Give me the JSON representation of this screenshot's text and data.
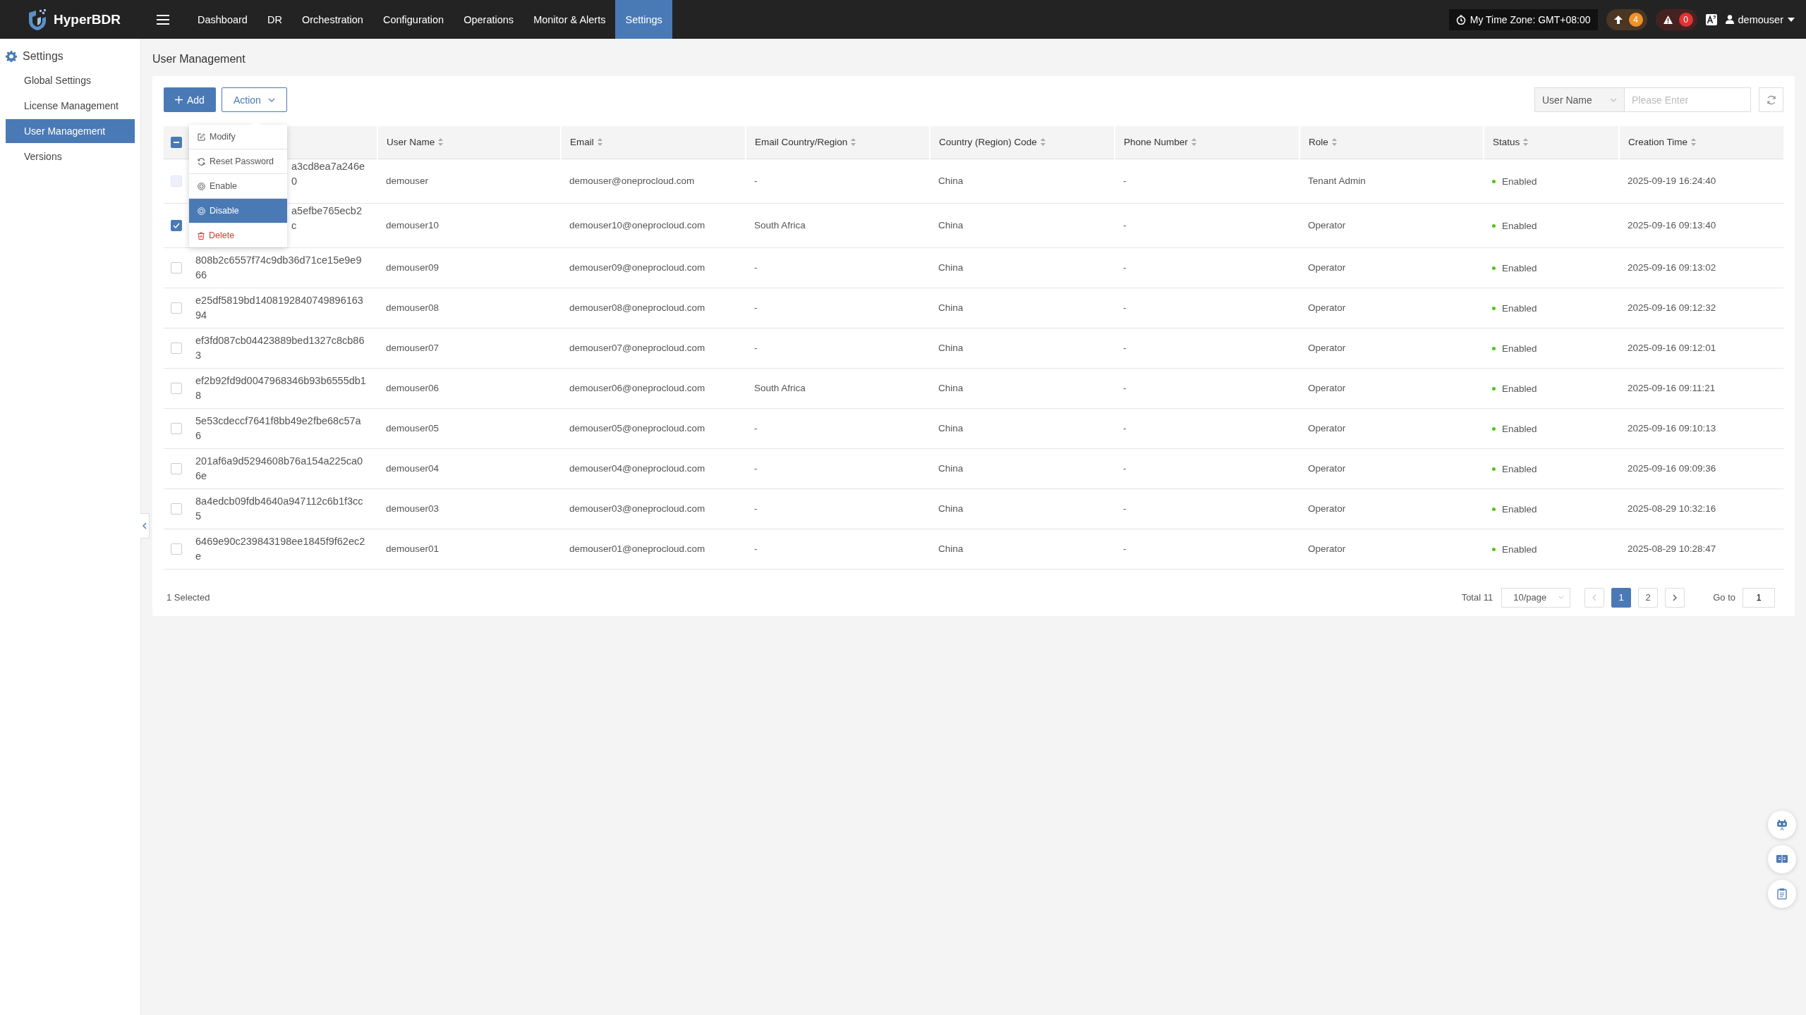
{
  "brand": "HyperBDR",
  "nav": [
    {
      "label": "Dashboard",
      "selected": false
    },
    {
      "label": "DR",
      "selected": false
    },
    {
      "label": "Orchestration",
      "selected": false
    },
    {
      "label": "Configuration",
      "selected": false
    },
    {
      "label": "Operations",
      "selected": false
    },
    {
      "label": "Monitor & Alerts",
      "selected": false
    },
    {
      "label": "Settings",
      "selected": true
    }
  ],
  "timezone": "My Time Zone: GMT+08:00",
  "upload_count": "4",
  "alert_count": "0",
  "user": "demouser",
  "sidebar": {
    "title": "Settings",
    "items": [
      {
        "label": "Global Settings",
        "selected": false
      },
      {
        "label": "License Management",
        "selected": false
      },
      {
        "label": "User Management",
        "selected": true
      },
      {
        "label": "Versions",
        "selected": false
      }
    ]
  },
  "page_title": "User Management",
  "toolbar": {
    "add": "Add",
    "action": "Action",
    "filter_field": "User Name",
    "search_placeholder": "Please Enter"
  },
  "action_menu": [
    {
      "label": "Modify",
      "kind": "normal",
      "selected": false
    },
    {
      "label": "Reset Password",
      "kind": "normal",
      "selected": false
    },
    {
      "label": "Enable",
      "kind": "normal",
      "selected": false
    },
    {
      "label": "Disable",
      "kind": "normal",
      "selected": true
    },
    {
      "label": "Delete",
      "kind": "danger",
      "selected": false
    }
  ],
  "table": {
    "header_indeterminate": true,
    "columns": [
      "User Name",
      "Email",
      "Email Country/Region",
      "Country (Region) Code",
      "Phone Number",
      "Role",
      "Status",
      "Creation Time"
    ],
    "rows": [
      {
        "checked": false,
        "disabled": true,
        "id": "a3cd8ea7a246e0",
        "cells": [
          "demouser",
          "demouser@oneprocloud.com",
          "-",
          "China",
          "-",
          "Tenant Admin",
          "Enabled",
          "2025-09-19 16:24:40"
        ]
      },
      {
        "checked": true,
        "disabled": false,
        "id": "a5efbe765ecb2c",
        "cells": [
          "demouser10",
          "demouser10@oneprocloud.com",
          "South Africa",
          "China",
          "-",
          "Operator",
          "Enabled",
          "2025-09-16 09:13:40"
        ]
      },
      {
        "checked": false,
        "disabled": false,
        "id": "808b2c6557f74c9db36d71ce15e9e966",
        "cells": [
          "demouser09",
          "demouser09@oneprocloud.com",
          "-",
          "China",
          "-",
          "Operator",
          "Enabled",
          "2025-09-16 09:13:02"
        ]
      },
      {
        "checked": false,
        "disabled": false,
        "id": "e25df5819bd140819284074989616394",
        "cells": [
          "demouser08",
          "demouser08@oneprocloud.com",
          "-",
          "China",
          "-",
          "Operator",
          "Enabled",
          "2025-09-16 09:12:32"
        ]
      },
      {
        "checked": false,
        "disabled": false,
        "id": "ef3fd087cb04423889bed1327c8cb863",
        "cells": [
          "demouser07",
          "demouser07@oneprocloud.com",
          "-",
          "China",
          "-",
          "Operator",
          "Enabled",
          "2025-09-16 09:12:01"
        ]
      },
      {
        "checked": false,
        "disabled": false,
        "id": "ef2b92fd9d0047968346b93b6555db18",
        "cells": [
          "demouser06",
          "demouser06@oneprocloud.com",
          "South Africa",
          "China",
          "-",
          "Operator",
          "Enabled",
          "2025-09-16 09:11:21"
        ]
      },
      {
        "checked": false,
        "disabled": false,
        "id": "5e53cdeccf7641f8bb49e2fbe68c57a6",
        "cells": [
          "demouser05",
          "demouser05@oneprocloud.com",
          "-",
          "China",
          "-",
          "Operator",
          "Enabled",
          "2025-09-16 09:10:13"
        ]
      },
      {
        "checked": false,
        "disabled": false,
        "id": "201af6a9d5294608b76a154a225ca06e",
        "cells": [
          "demouser04",
          "demouser04@oneprocloud.com",
          "-",
          "China",
          "-",
          "Operator",
          "Enabled",
          "2025-09-16 09:09:36"
        ]
      },
      {
        "checked": false,
        "disabled": false,
        "id": "8a4edcb09fdb4640a947112c6b1f3cc5",
        "cells": [
          "demouser03",
          "demouser03@oneprocloud.com",
          "-",
          "China",
          "-",
          "Operator",
          "Enabled",
          "2025-08-29 10:32:16"
        ]
      },
      {
        "checked": false,
        "disabled": false,
        "id": "6469e90c239843198ee1845f9f62ec2e",
        "cells": [
          "demouser01",
          "demouser01@oneprocloud.com",
          "-",
          "China",
          "-",
          "Operator",
          "Enabled",
          "2025-08-29 10:28:47"
        ]
      }
    ]
  },
  "footer": {
    "selected": "1 Selected",
    "total": "Total 11",
    "page_size": "10/page",
    "pages": [
      {
        "label": "1",
        "selected": true
      },
      {
        "label": "2",
        "selected": false
      }
    ],
    "goto_label": "Go to",
    "goto_value": "1"
  }
}
